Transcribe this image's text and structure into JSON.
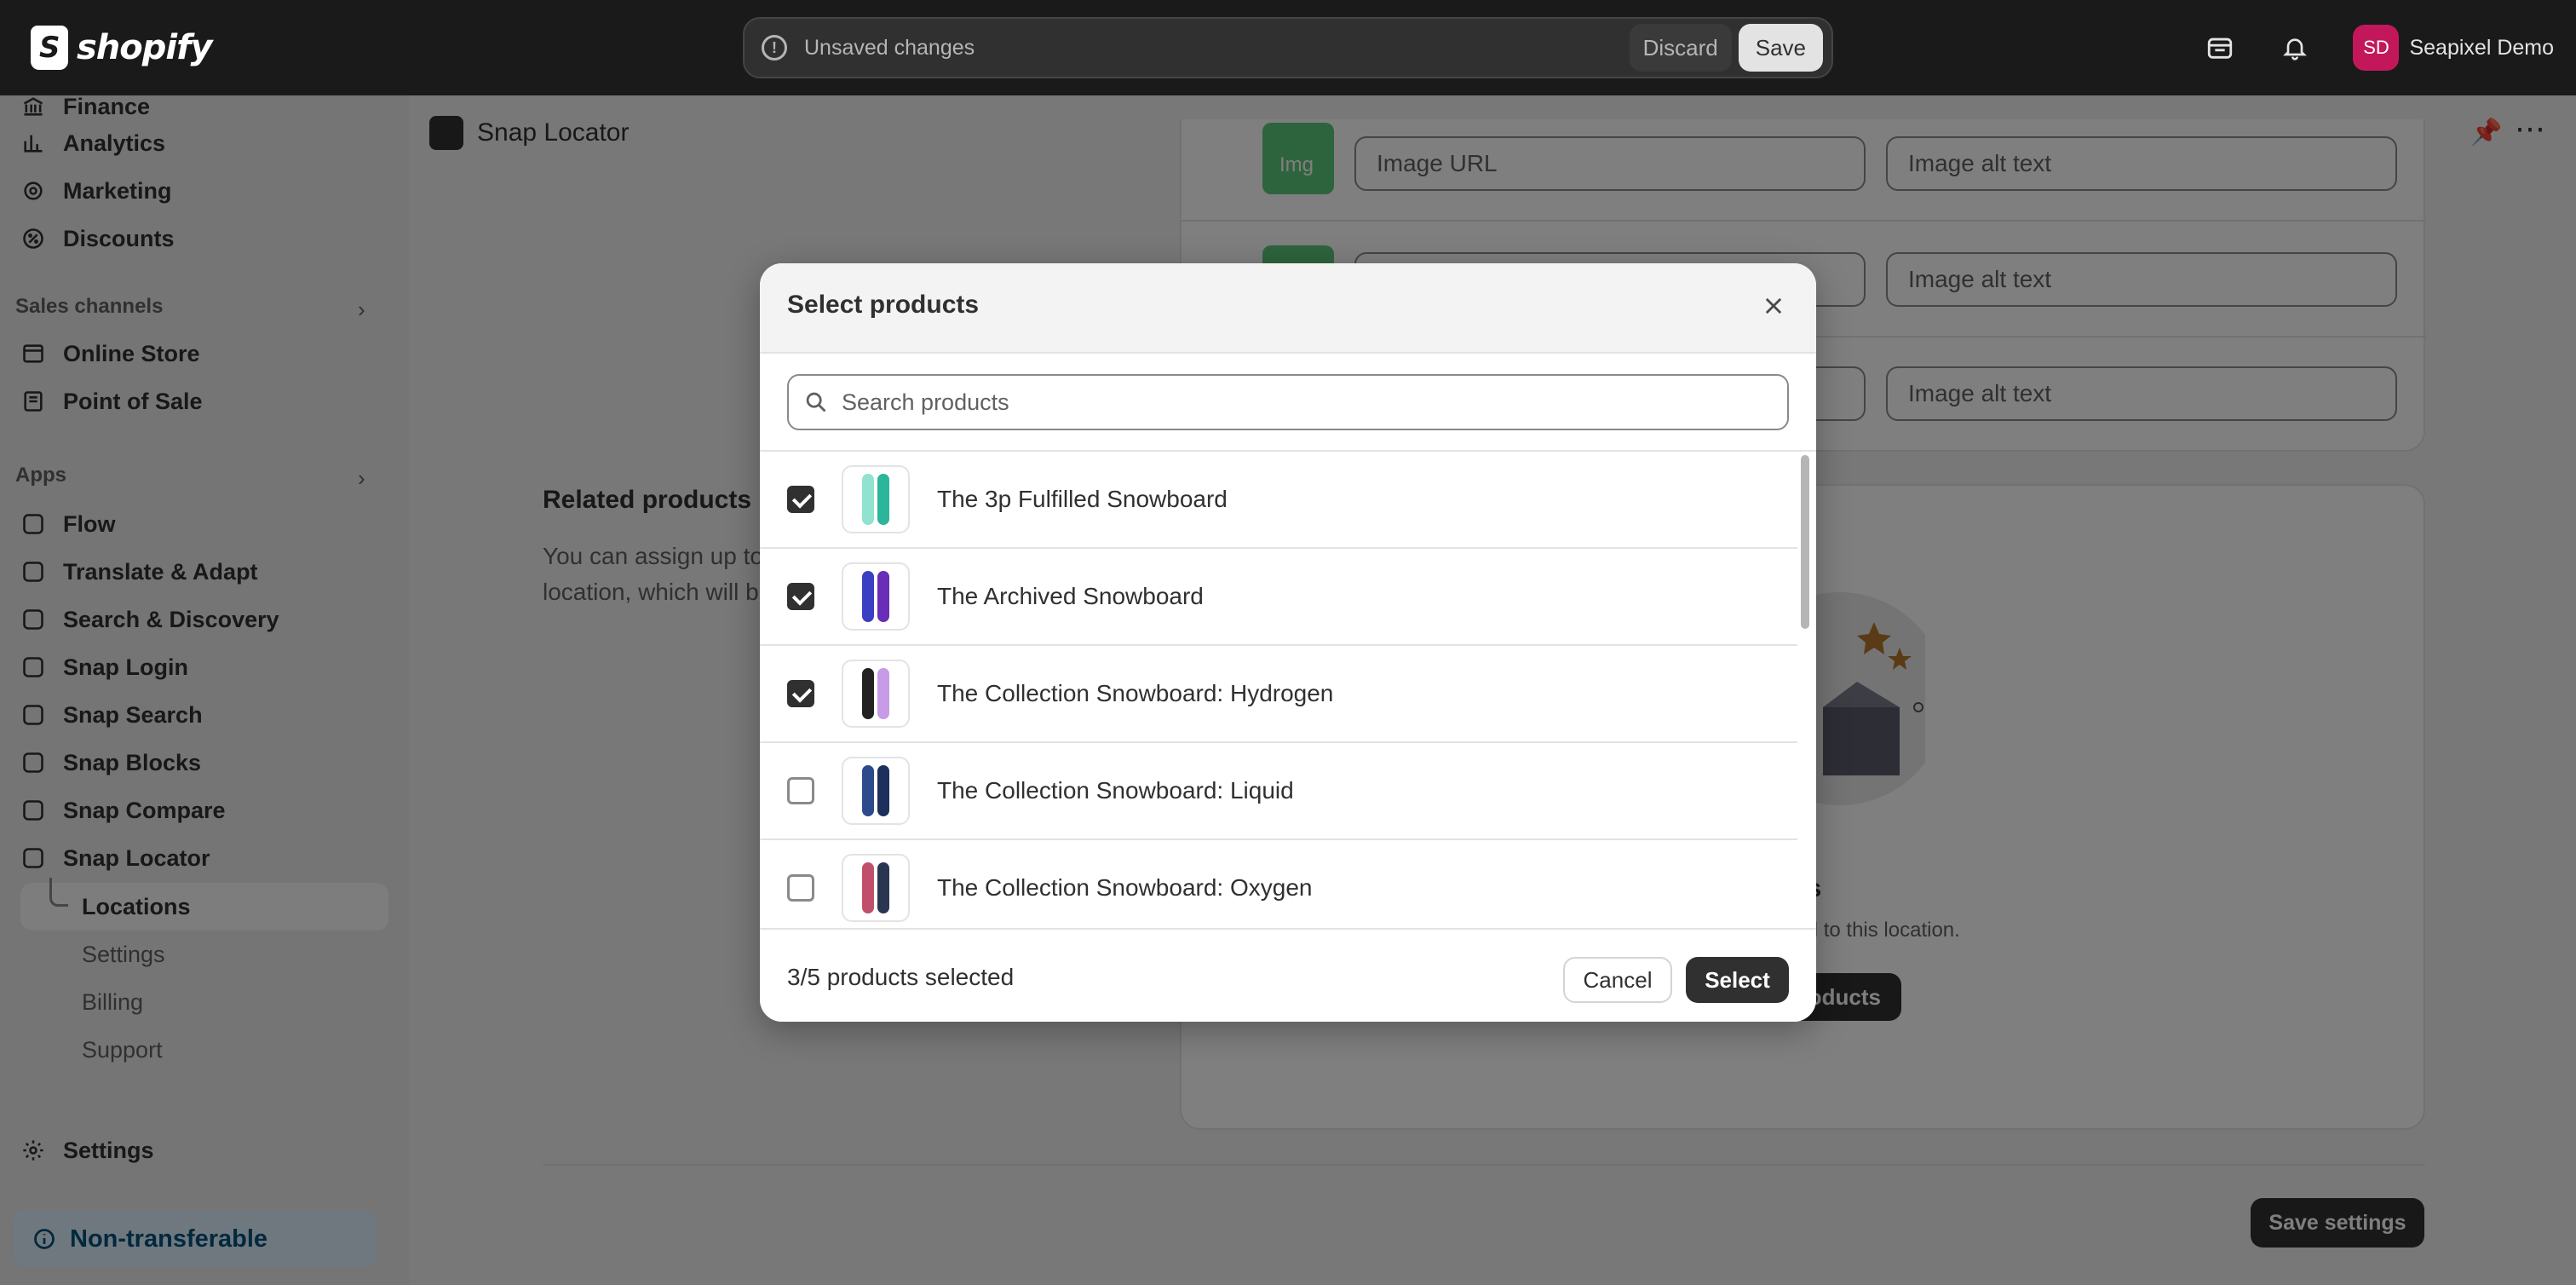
{
  "topbar": {
    "logo_text": "shopify",
    "unsaved_text": "Unsaved changes",
    "discard_label": "Discard",
    "save_label": "Save",
    "account_initials": "SD",
    "account_name": "Seapixel Demo"
  },
  "sidebar": {
    "items": [
      {
        "label": "Finance",
        "icon": "bank-icon"
      },
      {
        "label": "Analytics",
        "icon": "chart-icon"
      },
      {
        "label": "Marketing",
        "icon": "target-icon"
      },
      {
        "label": "Discounts",
        "icon": "discount-icon"
      }
    ],
    "sales_channels_label": "Sales channels",
    "sales_channels": [
      {
        "label": "Online Store"
      },
      {
        "label": "Point of Sale"
      }
    ],
    "apps_label": "Apps",
    "apps": [
      {
        "label": "Flow"
      },
      {
        "label": "Translate & Adapt"
      },
      {
        "label": "Search & Discovery"
      },
      {
        "label": "Snap Login"
      },
      {
        "label": "Snap Search"
      },
      {
        "label": "Snap Blocks"
      },
      {
        "label": "Snap Compare"
      },
      {
        "label": "Snap Locator"
      }
    ],
    "sub_items": [
      {
        "label": "Locations"
      },
      {
        "label": "Settings"
      },
      {
        "label": "Billing"
      },
      {
        "label": "Support"
      }
    ],
    "settings_label": "Settings",
    "non_transferable_label": "Non-transferable"
  },
  "app": {
    "title": "Snap Locator"
  },
  "main": {
    "thumb_label": "Img",
    "image_url_placeholder": "Image URL",
    "image_alt_placeholder": "Image alt text",
    "related_title": "Related products",
    "related_desc": "You can assign up to location, which will b",
    "empty_title": "products",
    "empty_desc": "ucts related to this location.",
    "empty_button": "oducts",
    "save_settings_label": "Save settings"
  },
  "modal": {
    "title": "Select products",
    "search_placeholder": "Search products",
    "products": [
      {
        "name": "The 3p Fulfilled Snowboard",
        "checked": true,
        "colors": [
          "#8fe3cf",
          "#2bb59a"
        ]
      },
      {
        "name": "The Archived Snowboard",
        "checked": true,
        "colors": [
          "#3b3fc4",
          "#6a2db8"
        ]
      },
      {
        "name": "The Collection Snowboard: Hydrogen",
        "checked": true,
        "colors": [
          "#222222",
          "#c79be8"
        ]
      },
      {
        "name": "The Collection Snowboard: Liquid",
        "checked": false,
        "colors": [
          "#2d4a8c",
          "#1e2f5c"
        ]
      },
      {
        "name": "The Collection Snowboard: Oxygen",
        "checked": false,
        "colors": [
          "#c0506a",
          "#2a3550"
        ]
      }
    ],
    "selected_count_text": "3/5 products selected",
    "cancel_label": "Cancel",
    "select_label": "Select"
  }
}
